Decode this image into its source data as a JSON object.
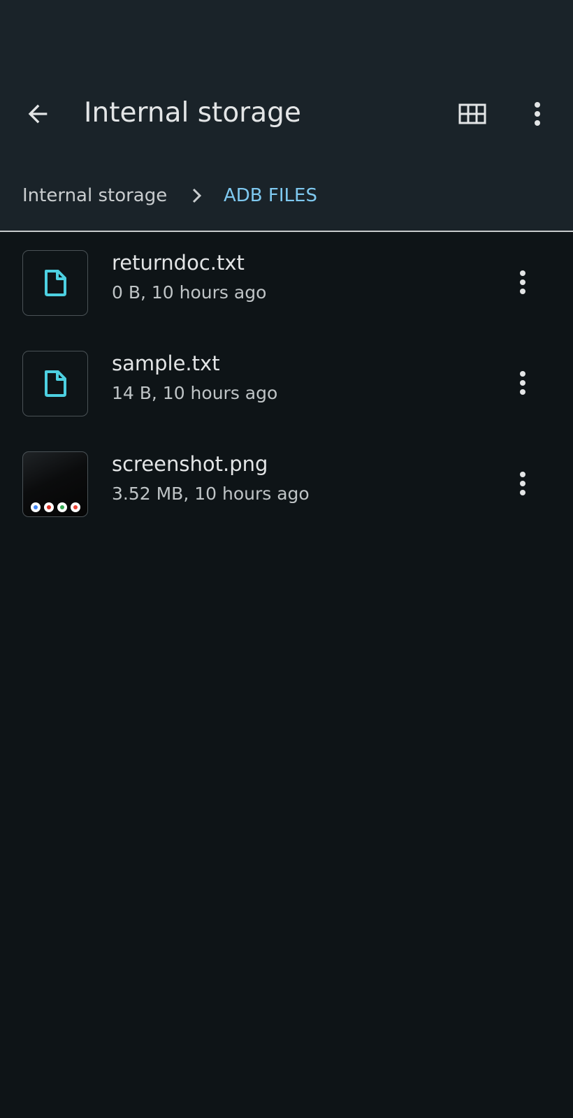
{
  "app_bar": {
    "title": "Internal storage",
    "icons": {
      "back": "arrow-back-icon",
      "grid": "grid-view-icon",
      "more": "more-vert-icon"
    }
  },
  "breadcrumb": {
    "root": "Internal storage",
    "separator_icon": "chevron-right-icon",
    "current": "ADB FILES"
  },
  "files": [
    {
      "name": "returndoc.txt",
      "meta": "0 B, 10 hours ago",
      "icon": "document-icon"
    },
    {
      "name": "sample.txt",
      "meta": "14 B, 10 hours ago",
      "icon": "document-icon"
    },
    {
      "name": "screenshot.png",
      "meta": "3.52 MB, 10 hours ago",
      "icon": "image-thumbnail"
    }
  ],
  "colors": {
    "background": "#0e1417",
    "top_bar": "#1a2329",
    "accent": "#7fc9f0",
    "file_icon": "#4dd0e1"
  }
}
